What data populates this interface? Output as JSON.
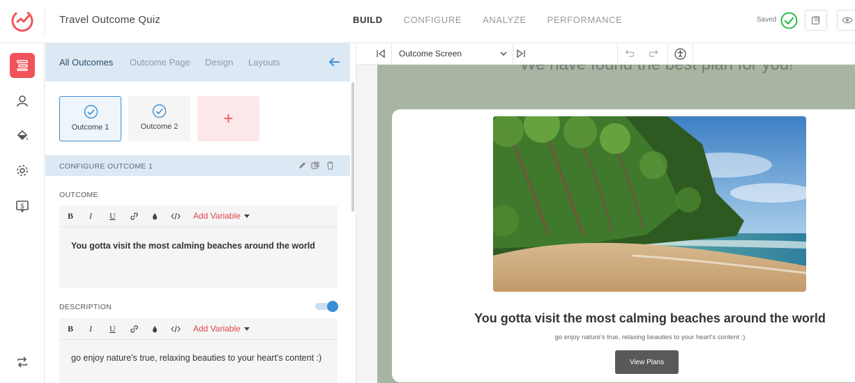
{
  "app": {
    "title": "Travel Outcome Quiz",
    "logo_icon": "logo-icon",
    "brand_color": "#f0545a"
  },
  "nav": {
    "tabs": [
      {
        "label": "BUILD",
        "active": true
      },
      {
        "label": "CONFIGURE"
      },
      {
        "label": "ANALYZE"
      },
      {
        "label": "PERFORMANCE"
      }
    ]
  },
  "status": {
    "saved_label": "Saved",
    "saved_color": "#2cbb46"
  },
  "rail": {
    "icons": [
      "outcomes-icon",
      "user-icon",
      "paint-bucket-icon",
      "gear-icon",
      "money-report-icon",
      "sync-icon"
    ]
  },
  "panel": {
    "subtabs": [
      "All Outcomes",
      "Outcome Page",
      "Design",
      "Layouts"
    ],
    "outcomes": [
      {
        "label": "Outcome 1",
        "selected": true
      },
      {
        "label": "Outcome 2"
      }
    ],
    "add_label": "+",
    "config_title": "CONFIGURE OUTCOME 1",
    "outcome_section": {
      "label": "OUTCOME",
      "toolbar": {
        "bold": "B",
        "italic": "I",
        "underline": "U",
        "add_variable": "Add Variable"
      },
      "value": "You gotta visit the most calming beaches around the world"
    },
    "description_section": {
      "label": "DESCRIPTION",
      "toggle_on": true,
      "toolbar": {
        "bold": "B",
        "italic": "I",
        "underline": "U",
        "add_variable": "Add Variable"
      },
      "value": "go enjoy nature's true, relaxing beauties to your heart's content :)"
    }
  },
  "canvas": {
    "screen_select": "Outcome Screen",
    "preview": {
      "cut_heading": "We have found the best plan for you!",
      "title": "You gotta visit the most calming beaches around the world",
      "description": "go enjoy nature's true, relaxing beauties to your heart's content :)",
      "cta_label": "View Plans"
    }
  }
}
